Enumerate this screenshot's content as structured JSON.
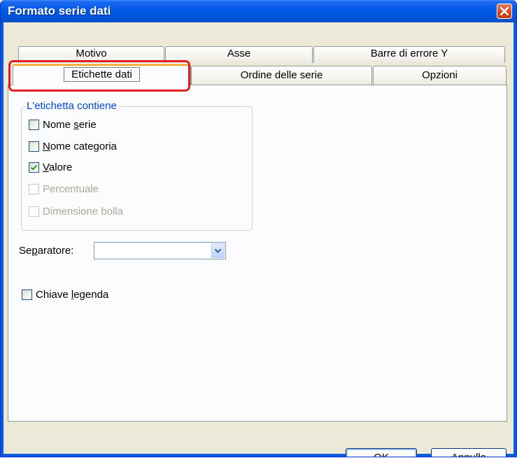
{
  "window": {
    "title": "Formato serie dati"
  },
  "tabs": {
    "row1": [
      "Motivo",
      "Asse",
      "Barre di errore Y"
    ],
    "row2": [
      "Etichette dati",
      "Ordine delle serie",
      "Opzioni"
    ]
  },
  "label_group": {
    "title": "L'etichetta contiene",
    "options": [
      {
        "label_pre": "Nome ",
        "label_accel": "s",
        "label_post": "erie",
        "checked": false,
        "enabled": true
      },
      {
        "label_pre": "",
        "label_accel": "N",
        "label_post": "ome categoria",
        "checked": false,
        "enabled": true
      },
      {
        "label_pre": "",
        "label_accel": "V",
        "label_post": "alore",
        "checked": true,
        "enabled": true
      },
      {
        "label_pre": "",
        "label_accel": "",
        "label_post": "Percentuale",
        "checked": false,
        "enabled": false
      },
      {
        "label_pre": "",
        "label_accel": "",
        "label_post": "Dimensione bolla",
        "checked": false,
        "enabled": false
      }
    ]
  },
  "separator": {
    "label_pre": "Se",
    "label_accel": "p",
    "label_post": "aratore:",
    "value": ""
  },
  "legend_key": {
    "label_pre": "Chiave ",
    "label_accel": "l",
    "label_post": "egenda",
    "checked": false
  },
  "buttons": {
    "ok": "OK",
    "cancel": "Annulla"
  },
  "colors": {
    "titlebar": "#0058e6",
    "dialog_bg": "#ece9d8",
    "tab_selected_accent": "#f5a000",
    "annotation": "#e02020",
    "group_title": "#0046d5"
  }
}
